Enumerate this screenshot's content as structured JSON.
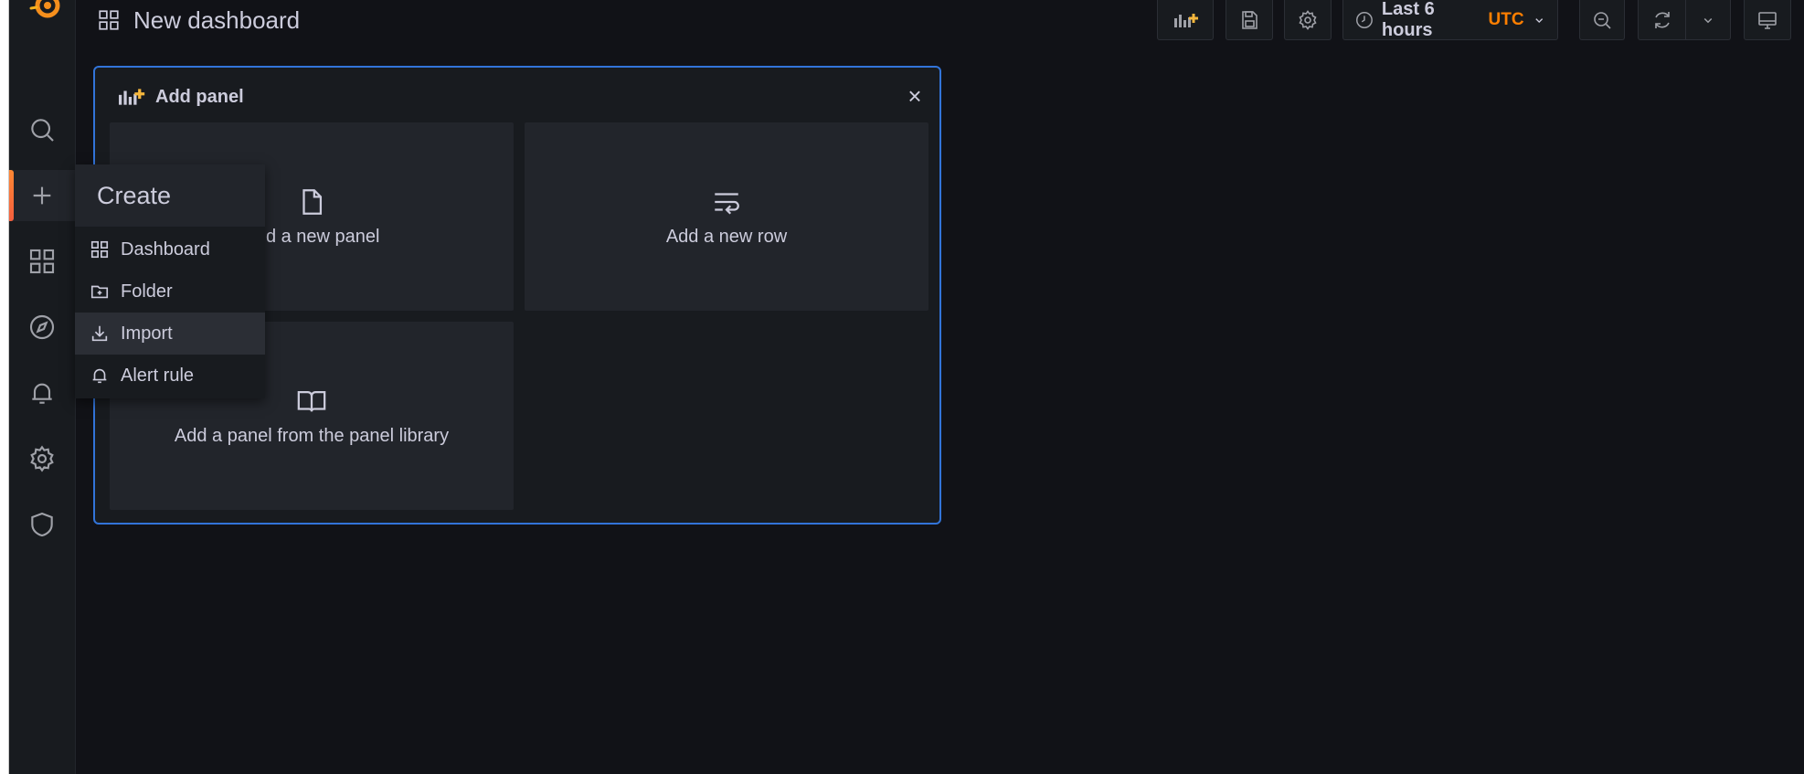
{
  "dashboard": {
    "title": "New dashboard"
  },
  "toolbar": {
    "add_panel_icon": "add-panel-icon",
    "save_icon": "save-icon",
    "settings_icon": "gear-icon",
    "time_range_label": "Last 6 hours",
    "timezone_label": "UTC",
    "zoom_out_icon": "zoom-out-icon",
    "refresh_icon": "refresh-icon",
    "refresh_interval_icon": "chevron-down-icon",
    "tv_mode_icon": "monitor-icon"
  },
  "sidebar": {
    "items": [
      {
        "name": "search",
        "icon": "search-icon"
      },
      {
        "name": "create",
        "icon": "plus-icon",
        "active": true
      },
      {
        "name": "dashboards",
        "icon": "apps-icon"
      },
      {
        "name": "explore",
        "icon": "compass-icon"
      },
      {
        "name": "alerting",
        "icon": "bell-icon"
      },
      {
        "name": "configuration",
        "icon": "gear-icon"
      },
      {
        "name": "server-admin",
        "icon": "shield-icon"
      }
    ]
  },
  "create_menu": {
    "header": "Create",
    "items": [
      {
        "label": "Dashboard",
        "icon": "apps-icon"
      },
      {
        "label": "Folder",
        "icon": "folder-plus-icon"
      },
      {
        "label": "Import",
        "icon": "import-icon",
        "hovered": true
      },
      {
        "label": "Alert rule",
        "icon": "bell-icon"
      }
    ]
  },
  "add_panel": {
    "title": "Add panel",
    "close_label": "×",
    "options": [
      {
        "label": "Add a new panel",
        "icon": "file-blank-icon"
      },
      {
        "label": "Add a new row",
        "icon": "wrap-text-icon"
      },
      {
        "label": "Add a panel from the panel library",
        "icon": "book-open-icon"
      }
    ]
  },
  "colors": {
    "background": "#111217",
    "panel": "#181b1f",
    "card": "#22252b",
    "accent_blue": "#3274d9",
    "accent_orange": "#ff7f00",
    "text": "#ccccdc"
  }
}
